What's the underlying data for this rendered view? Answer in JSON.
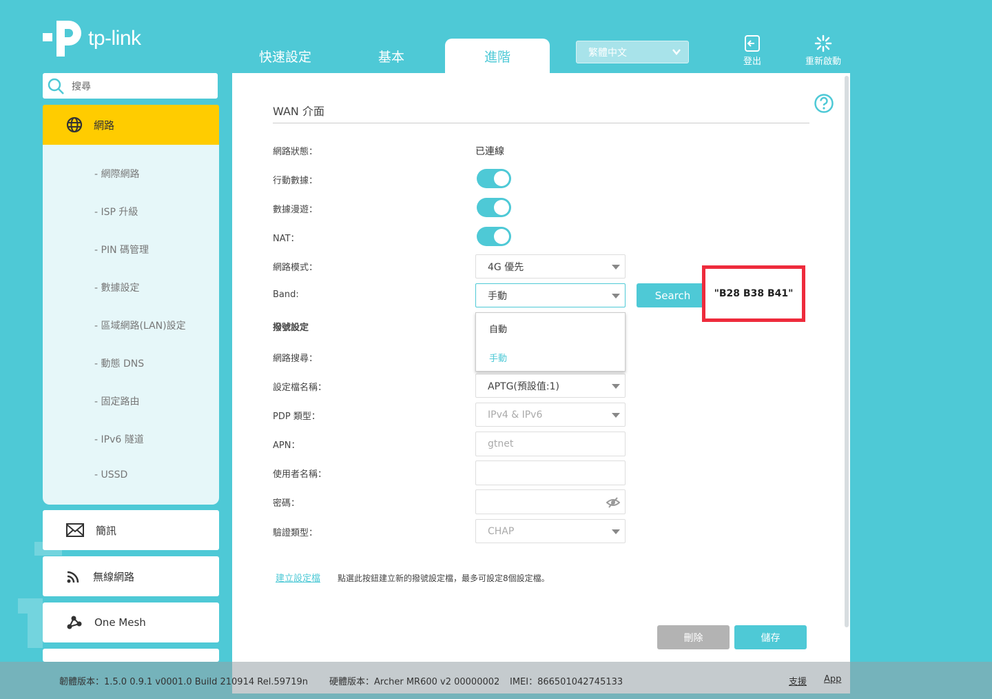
{
  "brand": {
    "name": "tp-link"
  },
  "topnav": {
    "quick": "快速設定",
    "basic": "基本",
    "advanced": "進階"
  },
  "language": {
    "selected": "繁體中文"
  },
  "top_actions": {
    "logout": "登出",
    "reboot": "重新啟動"
  },
  "sidebar": {
    "search_placeholder": "搜尋",
    "network": "網路",
    "sub": [
      "- 網際網路",
      "- ISP 升級",
      "- PIN 碼管理",
      "- 數據設定",
      "- 區域網路(LAN)設定",
      "- 動態 DNS",
      "- 固定路由",
      "- IPv6 隧道",
      "- USSD"
    ],
    "sms": "簡訊",
    "wireless": "無線網路",
    "onemesh": "One Mesh"
  },
  "panel": {
    "title": "WAN 介面",
    "fields": {
      "net_status_label": "網路狀態：",
      "net_status_value": "已連線",
      "mobile_data_label": "行動數據：",
      "roaming_label": "數據漫遊：",
      "nat_label": "NAT：",
      "net_mode_label": "網路模式：",
      "net_mode_value": "4G 優先",
      "band_label": "Band:",
      "band_value": "手動",
      "dial_settings_label": "撥號設定",
      "net_search_label": "網路搜尋：",
      "profile_label": "設定檔名稱：",
      "profile_value": "APTG(預設值:1)",
      "pdp_label": "PDP 類型：",
      "pdp_value": "IPv4 & IPv6",
      "apn_label": "APN：",
      "apn_value": "gtnet",
      "username_label": "使用者名稱：",
      "password_label": "密碼：",
      "auth_label": "驗證類型：",
      "auth_value": "CHAP"
    },
    "toggles": {
      "mobile_data": true,
      "roaming": true,
      "nat": true
    },
    "band_dropdown": {
      "options": [
        "自動",
        "手動"
      ],
      "highlighted": "手動"
    },
    "search_button": "Search",
    "band_annotation": "\"B28 B38 B41\"",
    "create_link": "建立設定檔",
    "create_desc": "點選此按鈕建立新的撥號設定檔，最多可設定8個設定檔。",
    "delete_button": "刪除",
    "save_button": "儲存"
  },
  "footer": {
    "firmware": "韌體版本：1.5.0 0.9.1 v0001.0 Build 210914 Rel.59719n",
    "hardware": "硬體版本：Archer MR600 v2 00000002",
    "imei": "IMEI：866501042745133",
    "support": "支援",
    "app": "App"
  },
  "colors": {
    "accent": "#4ec9d6",
    "active_nav": "#ffcc00",
    "annotation": "#ee2b3c"
  }
}
